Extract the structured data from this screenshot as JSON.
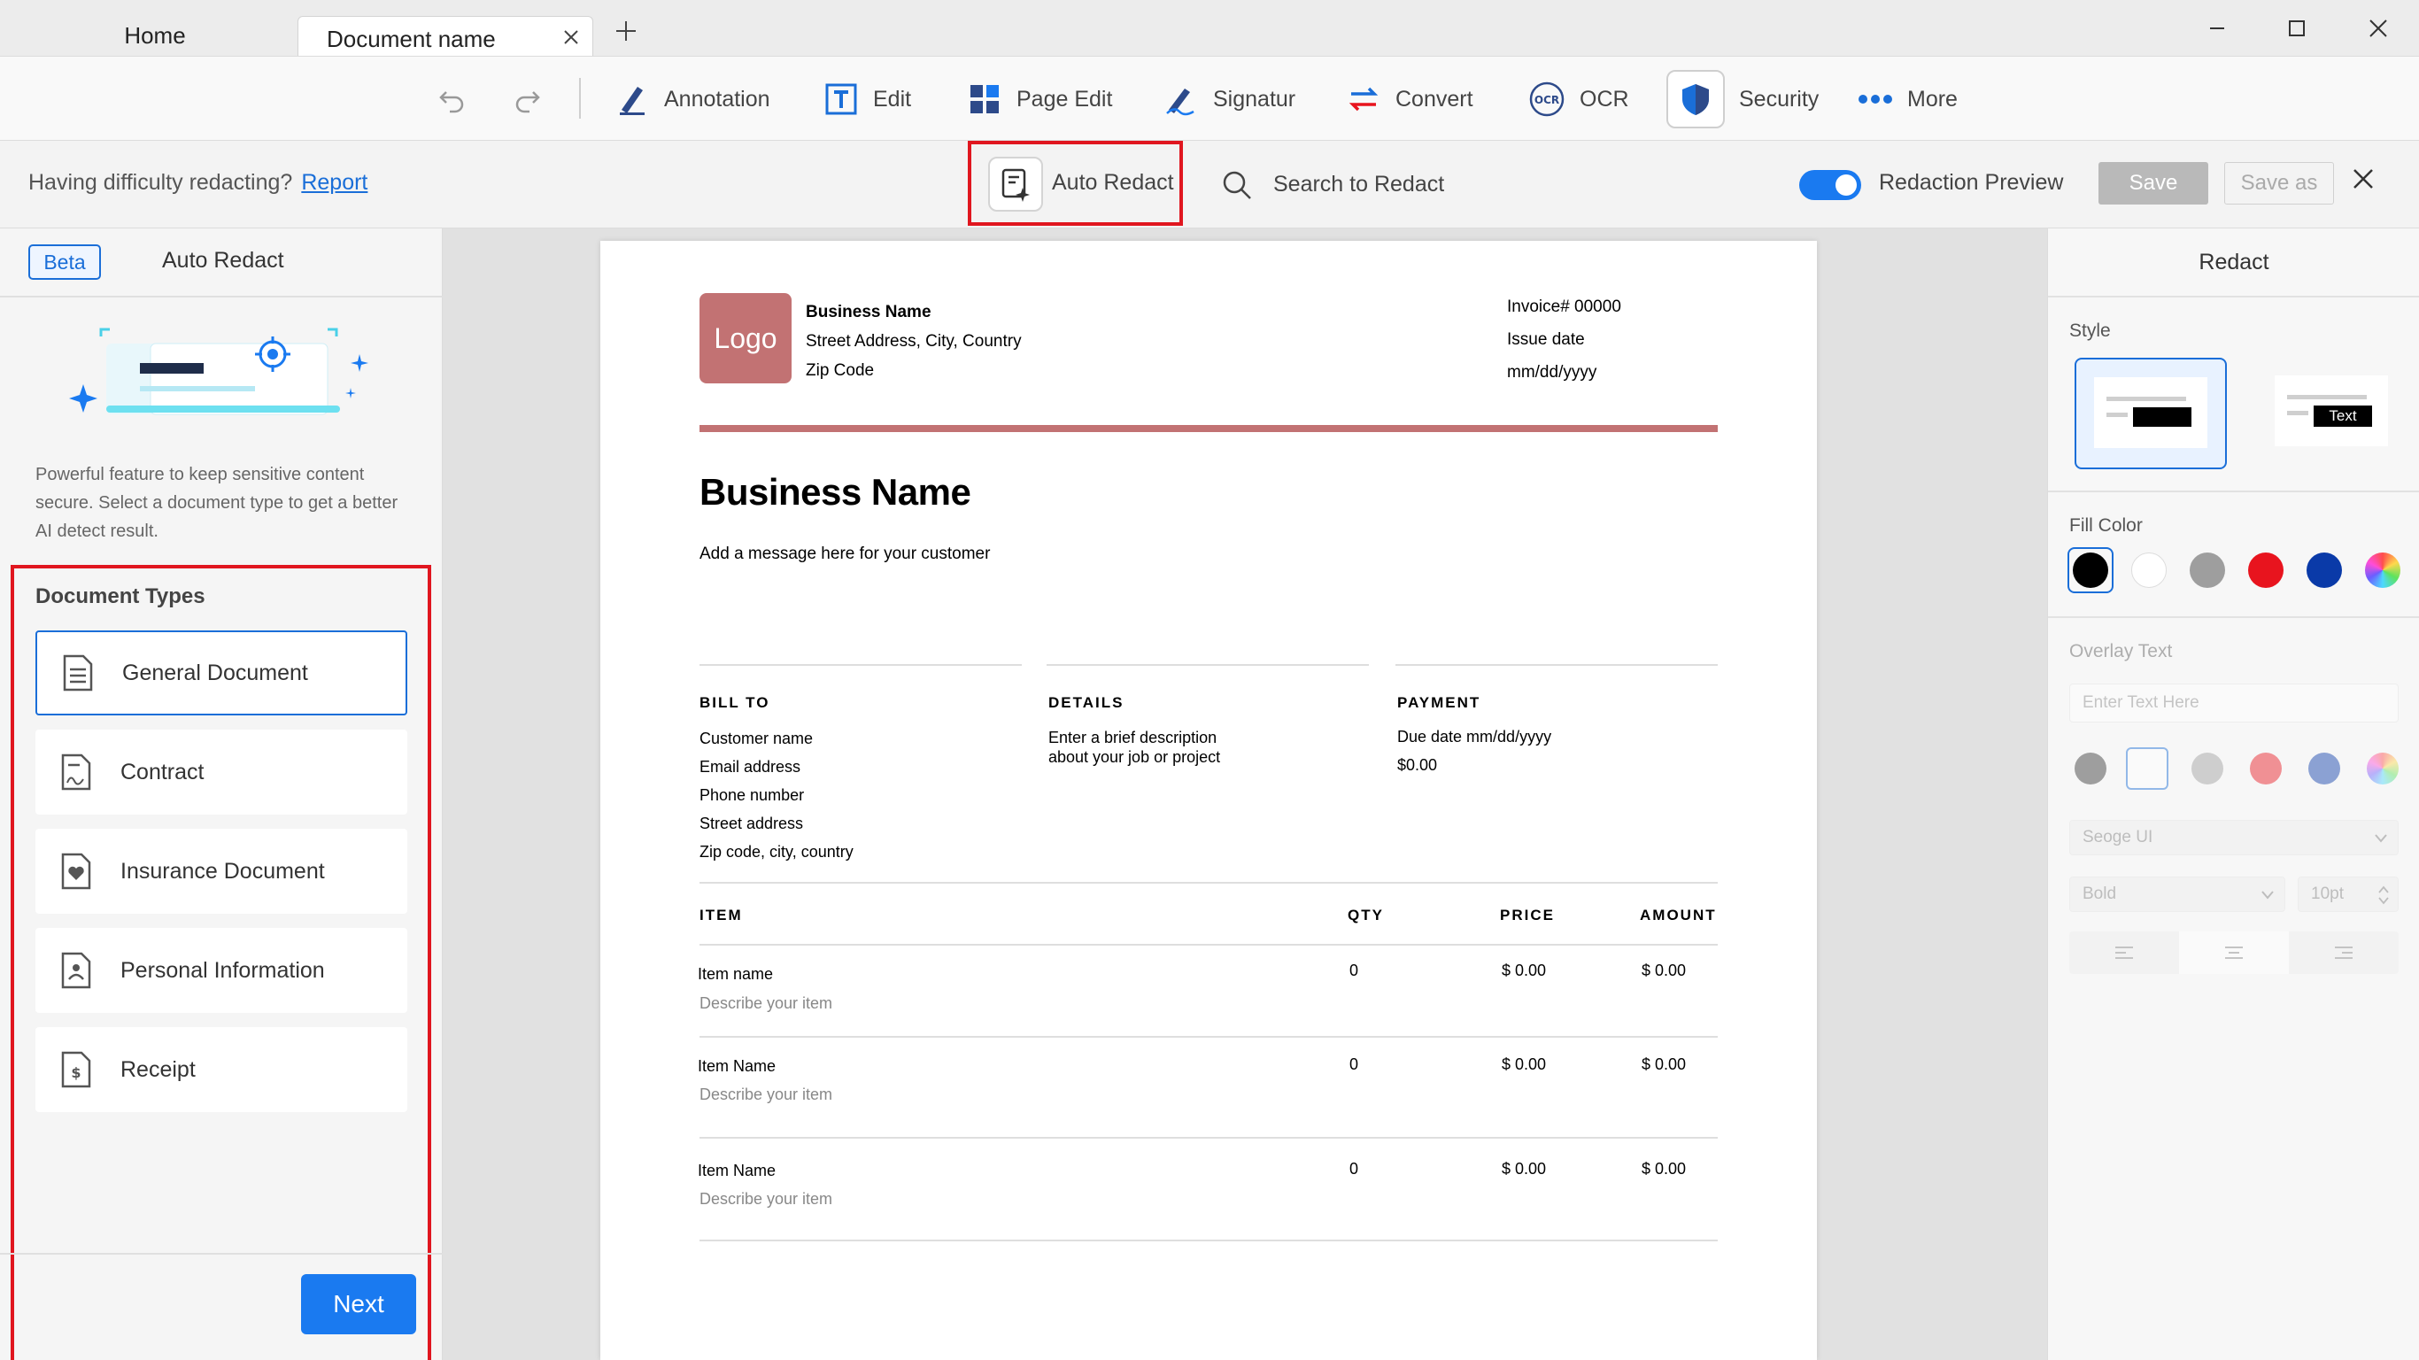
{
  "tabs": {
    "home": "Home",
    "document": "Document name"
  },
  "toolbar": {
    "annotation": "Annotation",
    "edit": "Edit",
    "page_edit": "Page Edit",
    "signature": "Signatur",
    "convert": "Convert",
    "ocr": "OCR",
    "security": "Security",
    "more": "More"
  },
  "redact_bar": {
    "message": "Having difficulty redacting?",
    "report_link": "Report",
    "auto_redact": "Auto Redact",
    "search_to_redact": "Search to Redact",
    "redaction_preview": "Redaction Preview",
    "redaction_preview_on": true,
    "save": "Save",
    "save_as": "Save as"
  },
  "left_panel": {
    "beta_badge": "Beta",
    "title": "Auto Redact",
    "description": "Powerful feature to keep sensitive content secure. Select a document type to get a better AI detect result.",
    "types_title": "Document Types",
    "types": [
      {
        "label": "General Document",
        "icon": "document-lines-icon",
        "selected": true
      },
      {
        "label": "Contract",
        "icon": "contract-signature-icon",
        "selected": false
      },
      {
        "label": "Insurance Document",
        "icon": "heart-document-icon",
        "selected": false
      },
      {
        "label": "Personal Information",
        "icon": "person-document-icon",
        "selected": false
      },
      {
        "label": "Receipt",
        "icon": "dollar-document-icon",
        "selected": false
      }
    ],
    "next_button": "Next"
  },
  "invoice": {
    "logo": "Logo",
    "business_name_small": "Business Name",
    "street": "Street Address, City, Country",
    "zip": "Zip Code",
    "invoice_no": "Invoice# 00000",
    "issue_date": "Issue date",
    "date_format": "mm/dd/yyyy",
    "business_name": "Business Name",
    "message": "Add a message here for your customer",
    "bill_to": {
      "header": "BILL TO",
      "lines": [
        "Customer name",
        "Email address",
        "Phone number",
        "Street address",
        "Zip code, city, country"
      ]
    },
    "details": {
      "header": "DETAILS",
      "lines": [
        "Enter a brief description",
        "about your job or project"
      ]
    },
    "payment": {
      "header": "PAYMENT",
      "lines": [
        "Due date mm/dd/yyyy",
        "$0.00"
      ]
    },
    "table_headers": {
      "item": "ITEM",
      "qty": "QTY",
      "price": "PRICE",
      "amount": "AMOUNT"
    },
    "items": [
      {
        "name": "Item name",
        "desc": "Describe your item",
        "qty": "0",
        "price": "$ 0.00",
        "amount": "$ 0.00"
      },
      {
        "name": "Item Name",
        "desc": "Describe your item",
        "qty": "0",
        "price": "$ 0.00",
        "amount": "$ 0.00"
      },
      {
        "name": "Item Name",
        "desc": "Describe your item",
        "qty": "0",
        "price": "$ 0.00",
        "amount": "$ 0.00"
      }
    ]
  },
  "right_panel": {
    "title": "Redact",
    "style_label": "Style",
    "style_text_sample": "Text",
    "fill_color_label": "Fill Color",
    "fill_colors": [
      "#000000",
      "#ffffff",
      "#9e9e9e",
      "#e8141e",
      "#0a3aa8"
    ],
    "overlay_text_label": "Overlay Text",
    "overlay_placeholder": "Enter Text Here",
    "text_colors": [
      "#333333",
      "#ffffff",
      "#9e9e9e",
      "#e8141e",
      "#0a3aa8"
    ],
    "font": "Seoge UI",
    "weight": "Bold",
    "size": "10pt"
  },
  "colors": {
    "accent": "#1a7af0",
    "highlight": "#e0161f",
    "invoice_accent": "#c27273"
  }
}
